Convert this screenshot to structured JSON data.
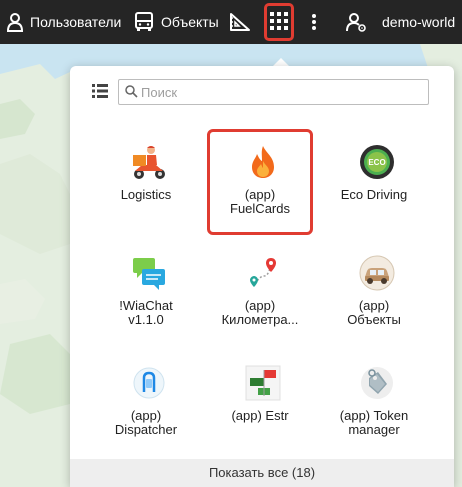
{
  "topbar": {
    "users_label": "Пользователи",
    "objects_label": "Объекты",
    "account_label": "demo-world",
    "icons": {
      "users": "user-icon",
      "objects": "bus-icon",
      "ruler": "ruler-triangle-icon",
      "apps": "grid-icon",
      "more": "vertical-dots-icon",
      "account": "account-gear-icon"
    }
  },
  "popup": {
    "search_placeholder": "Поиск",
    "show_all_label": "Показать все (18)",
    "apps": [
      {
        "line1": "Logistics",
        "line2": "",
        "icon": "courier-scooter-icon"
      },
      {
        "line1": "(app)",
        "line2": "FuelCards",
        "icon": "flame-icon"
      },
      {
        "line1": "Eco Driving",
        "line2": "",
        "icon": "eco-steering-wheel-icon"
      },
      {
        "line1": "!WiaChat",
        "line2": "v1.1.0",
        "icon": "chat-bubbles-icon"
      },
      {
        "line1": "(app)",
        "line2": "Километра...",
        "icon": "route-pins-icon"
      },
      {
        "line1": "(app)",
        "line2": "Объекты",
        "icon": "car-icon"
      },
      {
        "line1": "(app)",
        "line2": "Dispatcher",
        "icon": "dispatcher-icon"
      },
      {
        "line1": "(app) Estr",
        "line2": "",
        "icon": "estr-flags-icon"
      },
      {
        "line1": "(app) Token",
        "line2": "manager",
        "icon": "token-tag-icon"
      }
    ]
  },
  "colors": {
    "topbar_bg": "#252525",
    "highlight": "#e03c31",
    "map_water": "#c9e4f1",
    "map_land": "#e4eee0"
  }
}
